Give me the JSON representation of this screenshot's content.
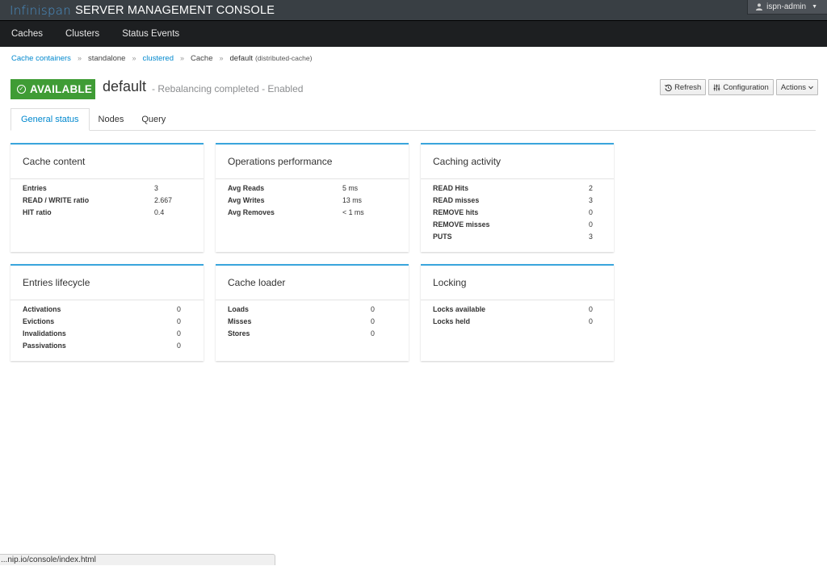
{
  "brand": {
    "logo": "Infinispan",
    "title": "SERVER MANAGEMENT CONSOLE"
  },
  "user": {
    "name": "ispn-admin"
  },
  "nav": {
    "items": [
      "Caches",
      "Clusters",
      "Status Events"
    ]
  },
  "breadcrumb": {
    "containers": "Cache containers",
    "standalone": "standalone",
    "clustered": "clustered",
    "cache": "Cache",
    "current": "default",
    "current_sub": "(distributed-cache)",
    "separator": "»"
  },
  "header": {
    "status_badge": "AVAILABLE",
    "cache_name": "default",
    "cache_status": "- Rebalancing completed  - Enabled",
    "refresh": "Refresh",
    "configuration": "Configuration",
    "actions": "Actions"
  },
  "tabs": [
    "General status",
    "Nodes",
    "Query"
  ],
  "cards": {
    "cache_content": {
      "title": "Cache content",
      "rows": [
        {
          "label": "Entries",
          "value": "3"
        },
        {
          "label": "READ / WRITE ratio",
          "value": "2.667"
        },
        {
          "label": "HIT ratio",
          "value": "0.4"
        }
      ]
    },
    "operations": {
      "title": "Operations performance",
      "rows": [
        {
          "label": "Avg Reads",
          "value": "5 ms"
        },
        {
          "label": "Avg Writes",
          "value": "13 ms"
        },
        {
          "label": "Avg Removes",
          "value": "< 1 ms"
        }
      ]
    },
    "caching_activity": {
      "title": "Caching activity",
      "rows": [
        {
          "label": "READ Hits",
          "value": "2"
        },
        {
          "label": "READ misses",
          "value": "3"
        },
        {
          "label": "REMOVE hits",
          "value": "0"
        },
        {
          "label": "REMOVE misses",
          "value": "0"
        },
        {
          "label": "PUTS",
          "value": "3"
        }
      ]
    },
    "entries_lifecycle": {
      "title": "Entries lifecycle",
      "rows": [
        {
          "label": "Activations",
          "value": "0"
        },
        {
          "label": "Evictions",
          "value": "0"
        },
        {
          "label": "Invalidations",
          "value": "0"
        },
        {
          "label": "Passivations",
          "value": "0"
        }
      ]
    },
    "cache_loader": {
      "title": "Cache loader",
      "rows": [
        {
          "label": "Loads",
          "value": "0"
        },
        {
          "label": "Misses",
          "value": "0"
        },
        {
          "label": "Stores",
          "value": "0"
        }
      ]
    },
    "locking": {
      "title": "Locking",
      "rows": [
        {
          "label": "Locks available",
          "value": "0"
        },
        {
          "label": "Locks held",
          "value": "0"
        }
      ]
    }
  },
  "status_bar": {
    "url": "...nip.io/console/index.html"
  },
  "colors": {
    "accent": "#0088ce",
    "available": "#3f9c35",
    "card_top": "#39a5dc"
  },
  "icons": {
    "user": "user-icon",
    "refresh": "history-icon",
    "configuration": "sliders-icon",
    "actions": "caret-down-icon",
    "available": "check-circle-icon"
  }
}
